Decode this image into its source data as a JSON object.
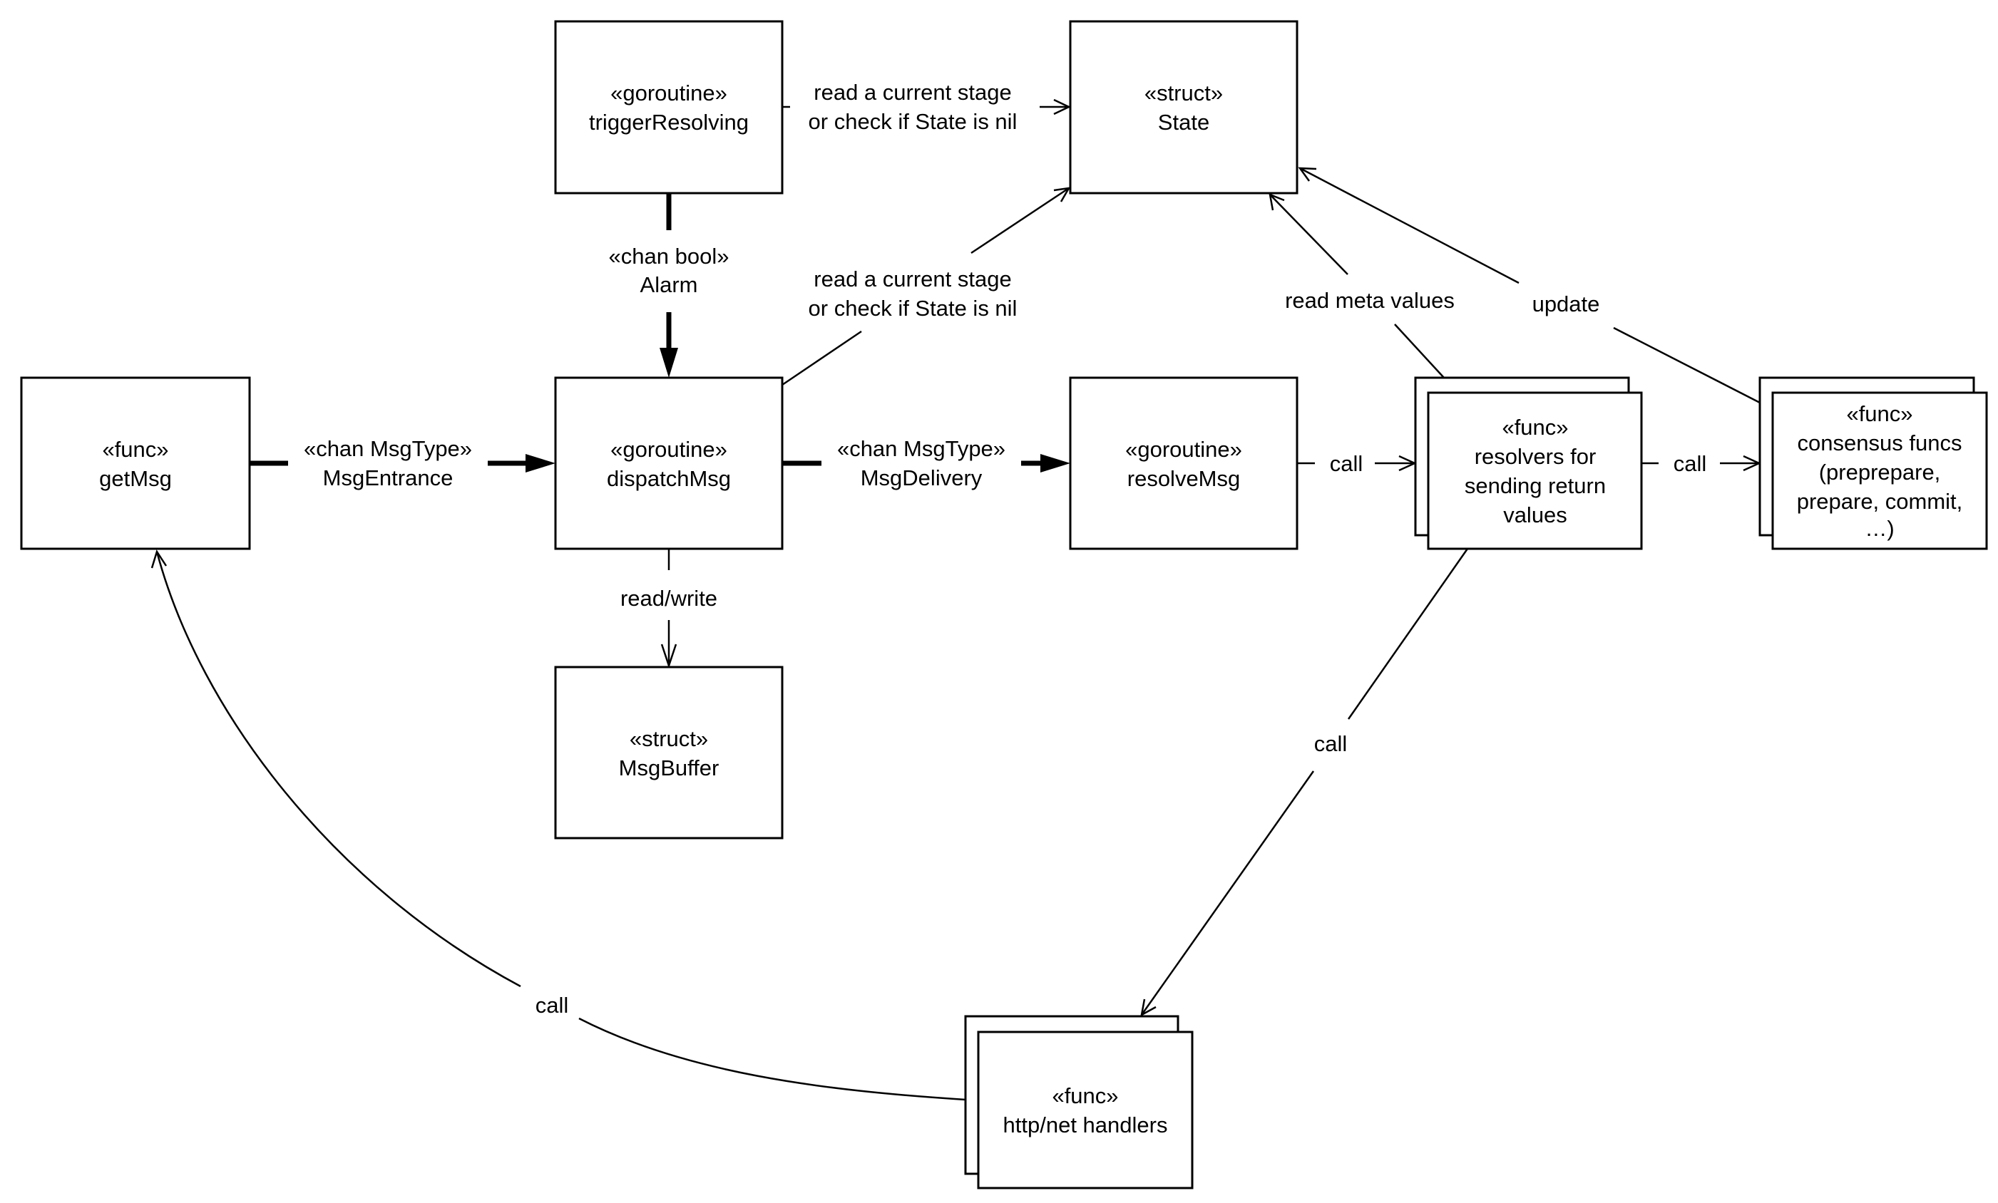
{
  "diagram": {
    "type": "uml-component-flow",
    "nodes": {
      "getMsg": {
        "stereotype": "«func»",
        "name": "getMsg",
        "stacked": false
      },
      "triggerResolving": {
        "stereotype": "«goroutine»",
        "name": "triggerResolving",
        "stacked": false
      },
      "state": {
        "stereotype": "«struct»",
        "name": "State",
        "stacked": false
      },
      "dispatchMsg": {
        "stereotype": "«goroutine»",
        "name": "dispatchMsg",
        "stacked": false
      },
      "msgBuffer": {
        "stereotype": "«struct»",
        "name": "MsgBuffer",
        "stacked": false
      },
      "resolveMsg": {
        "stereotype": "«goroutine»",
        "name": "resolveMsg",
        "stacked": false
      },
      "resolvers": {
        "stereotype": "«func»",
        "lines": [
          "resolvers for",
          "sending return",
          "values"
        ],
        "stacked": true
      },
      "consensus": {
        "stereotype": "«func»",
        "lines": [
          "consensus funcs",
          "(preprepare,",
          "prepare, commit,",
          "…)"
        ],
        "stacked": true
      },
      "httpHandlers": {
        "stereotype": "«func»",
        "name": "http/net handlers",
        "stacked": true
      }
    },
    "edges": {
      "trigger_to_state": {
        "lines": [
          "read a current stage",
          "or check if State is nil"
        ],
        "from": "triggerResolving",
        "to": "State",
        "style": "open-arrow"
      },
      "alarm": {
        "lines": [
          "«chan bool»",
          "Alarm"
        ],
        "from": "triggerResolving",
        "to": "dispatchMsg",
        "style": "channel"
      },
      "dispatch_to_state": {
        "lines": [
          "read a current stage",
          "or check if State is nil"
        ],
        "from": "dispatchMsg",
        "to": "State",
        "style": "open-arrow"
      },
      "msg_entrance": {
        "lines": [
          "«chan MsgType»",
          "MsgEntrance"
        ],
        "from": "getMsg",
        "to": "dispatchMsg",
        "style": "channel"
      },
      "msg_delivery": {
        "lines": [
          "«chan MsgType»",
          "MsgDelivery"
        ],
        "from": "dispatchMsg",
        "to": "resolveMsg",
        "style": "channel"
      },
      "read_write": {
        "label": "read/write",
        "from": "dispatchMsg",
        "to": "MsgBuffer",
        "style": "open-arrow"
      },
      "resolve_call": {
        "label": "call",
        "from": "resolveMsg",
        "to": "resolvers",
        "style": "open-arrow"
      },
      "resolvers_call": {
        "label": "call",
        "from": "resolvers",
        "to": "consensus funcs",
        "style": "open-arrow"
      },
      "read_meta": {
        "label": "read meta values",
        "from": "resolvers",
        "to": "State",
        "style": "open-arrow"
      },
      "update": {
        "label": "update",
        "from": "consensus funcs",
        "to": "State",
        "style": "open-arrow"
      },
      "resolvers_to_http": {
        "label": "call",
        "from": "resolvers",
        "to": "http/net handlers",
        "style": "open-arrow"
      },
      "http_to_getmsg": {
        "label": "call",
        "from": "http/net handlers",
        "to": "getMsg",
        "style": "open-arrow"
      }
    }
  }
}
